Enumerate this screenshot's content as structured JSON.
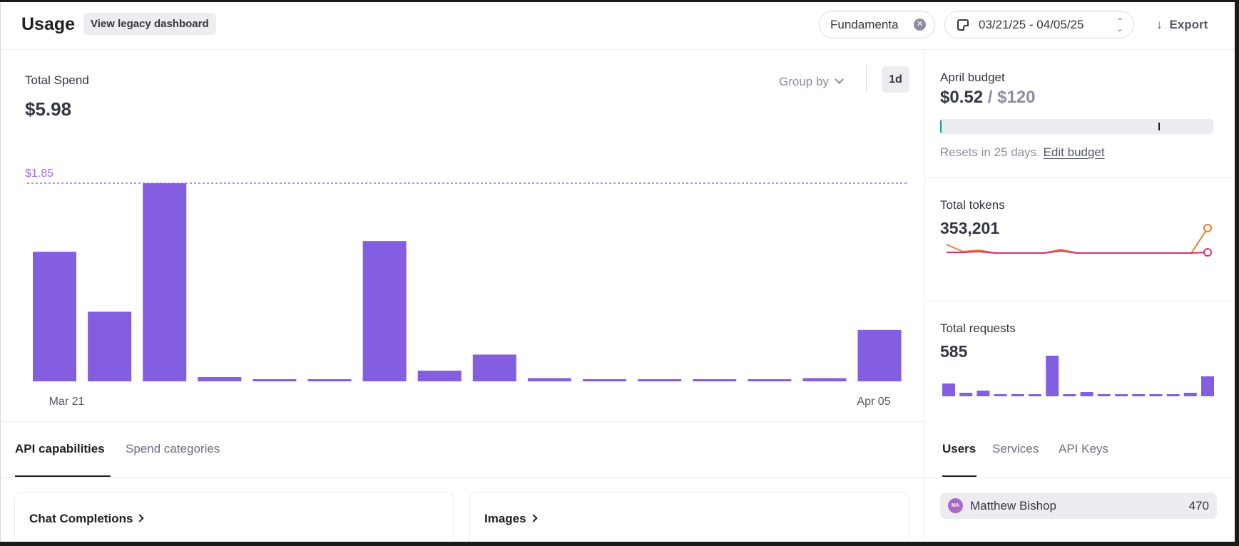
{
  "header": {
    "title": "Usage",
    "legacy_button": "View legacy dashboard",
    "project_filter": "Fundamenta",
    "date_range": "03/21/25 - 04/05/25",
    "export_label": "Export"
  },
  "spend": {
    "label": "Total Spend",
    "value": "$5.98",
    "group_by": "Group by",
    "interval": "1d",
    "max_label": "$1.85"
  },
  "budget": {
    "label": "April budget",
    "spent": "$0.52",
    "separator": " / ",
    "limit": "$120",
    "fill_fraction": 0.0043,
    "marker_fraction": 0.8,
    "reset_text": "Resets in 25 days.",
    "edit_label": "Edit budget"
  },
  "tokens": {
    "label": "Total tokens",
    "value": "353,201",
    "series": [
      {
        "color": "#ed7d31",
        "values": [
          13,
          3,
          5,
          1,
          1,
          1,
          1,
          6,
          1,
          1,
          1,
          1,
          1,
          1,
          1,
          1,
          36
        ]
      },
      {
        "color": "#d6336c",
        "values": [
          2,
          2,
          3,
          1,
          1,
          1,
          1,
          4,
          1,
          1,
          1,
          1,
          1,
          1,
          1,
          1,
          2
        ]
      }
    ]
  },
  "requests": {
    "label": "Total requests",
    "value": "585",
    "values": [
      18,
      5,
      8,
      3,
      3,
      3,
      57,
      3,
      6,
      3,
      3,
      3,
      3,
      3,
      5,
      28
    ]
  },
  "tabs_left": [
    {
      "label": "API capabilities",
      "active": true
    },
    {
      "label": "Spend categories",
      "active": false
    }
  ],
  "capabilities": [
    {
      "label": "Chat Completions"
    },
    {
      "label": "Images"
    }
  ],
  "tabs_right": [
    {
      "label": "Users",
      "active": true
    },
    {
      "label": "Services",
      "active": false
    },
    {
      "label": "API Keys",
      "active": false
    }
  ],
  "users": [
    {
      "initials": "MA",
      "name": "Matthew Bishop",
      "count": "470"
    }
  ],
  "chart_data": {
    "type": "bar",
    "categories": [
      "Mar 21",
      "Mar 22",
      "Mar 23",
      "Mar 24",
      "Mar 25",
      "Mar 26",
      "Mar 27",
      "Mar 28",
      "Mar 29",
      "Mar 30",
      "Mar 31",
      "Apr 01",
      "Apr 02",
      "Apr 03",
      "Apr 04",
      "Apr 05"
    ],
    "values": [
      1.21,
      0.65,
      1.85,
      0.04,
      0.02,
      0.02,
      1.31,
      0.1,
      0.25,
      0.03,
      0.02,
      0.02,
      0.02,
      0.02,
      0.03,
      0.48
    ],
    "tick_labels": [
      "Mar 21",
      "Apr 05"
    ],
    "reference_line": 1.85,
    "ylim": [
      0,
      1.85
    ],
    "bar_color": "#845ee1",
    "accent_color": "#9b6bf2"
  }
}
